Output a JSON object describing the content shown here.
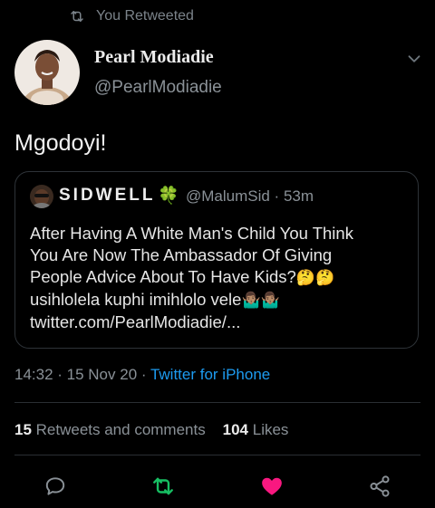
{
  "retweet_banner": {
    "text": "You Retweeted"
  },
  "author": {
    "name": "Pearl Modiadie",
    "handle": "@PearlModiadie"
  },
  "tweet": {
    "text": "Mgodoyi!"
  },
  "quoted": {
    "name": "SIDWELL",
    "name_emoji": "🍀",
    "handle_time": "@MalumSid · 53m",
    "lines": [
      "After Having A White Man's Child You Think",
      "You Are Now The Ambassador Of Giving",
      "People Advice About To Have Kids?",
      "usihlolela kuphi imihlolo vele",
      "twitter.com/PearlModiadie/..."
    ],
    "line3_emoji": "🤔🤔",
    "line4_emoji": "🤷🏽‍♂️🤷🏽‍♂️"
  },
  "meta": {
    "time_date": "14:32 · 15 Nov 20 · ",
    "source": "Twitter for iPhone"
  },
  "stats": {
    "retweets_count": "15",
    "retweets_label": " Retweets and comments",
    "likes_count": "104",
    "likes_label": " Likes"
  },
  "colors": {
    "accent": "#1d9bf0",
    "retweet_green": "#17bf63",
    "like_red": "#f91880"
  },
  "icons": [
    "retweet-icon",
    "chevron-down-icon",
    "reply-icon",
    "retweet-icon",
    "heart-icon",
    "share-icon"
  ]
}
